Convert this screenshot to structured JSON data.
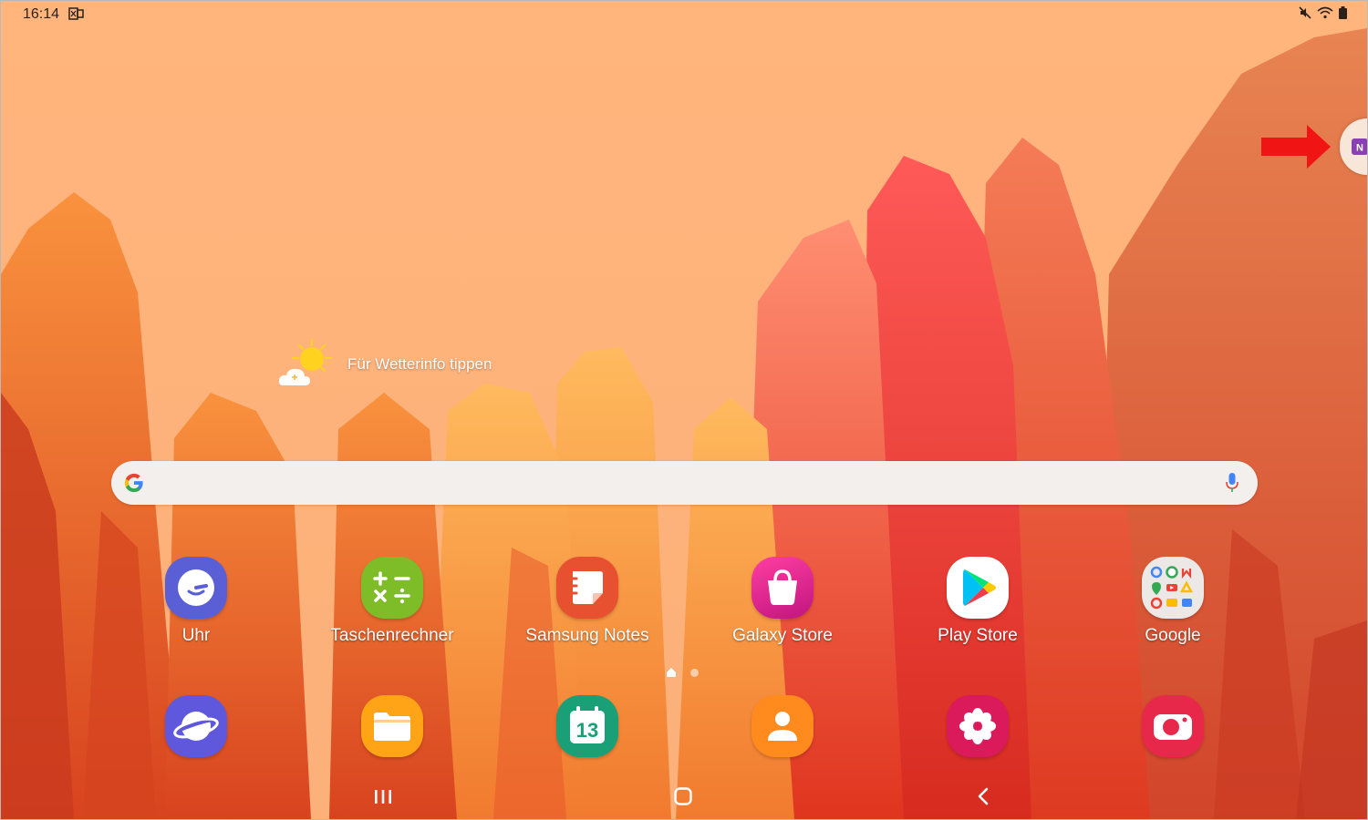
{
  "status_bar": {
    "time": "16:14",
    "icons": [
      "notification-icon",
      "mute-icon",
      "wifi-icon",
      "battery-icon"
    ]
  },
  "edge_panel": {
    "icon": "onenote-icon",
    "letter": "N",
    "annotation": "arrow-icon"
  },
  "weather": {
    "label": "Für Wetterinfo tippen",
    "icon": "sun-cloud-icon"
  },
  "search": {
    "placeholder": "",
    "value": "",
    "icons": [
      "google-icon",
      "mic-icon"
    ]
  },
  "apps_row1": [
    {
      "label": "Uhr",
      "icon": "clock-icon",
      "color": "#5b5fd6"
    },
    {
      "label": "Taschenrechner",
      "icon": "calculator-icon",
      "color": "#7ebc28"
    },
    {
      "label": "Samsung Notes",
      "icon": "notes-icon",
      "color": "#e8512f"
    },
    {
      "label": "Galaxy Store",
      "icon": "store-bag-icon",
      "color": "#e3247c"
    },
    {
      "label": "Play Store",
      "icon": "play-store-icon",
      "color": "#ffffff"
    },
    {
      "label": "Google",
      "icon": "google-folder-icon",
      "color": "#ece8e6"
    }
  ],
  "apps_dock": [
    {
      "icon": "internet-icon",
      "color": "#6058dc"
    },
    {
      "icon": "folder-icon",
      "color": "#ffa417"
    },
    {
      "icon": "calendar-icon",
      "color": "#1a9f77",
      "text": "13"
    },
    {
      "icon": "contacts-icon",
      "color": "#ff8a1e"
    },
    {
      "icon": "gallery-icon",
      "color": "#da1a5a"
    },
    {
      "icon": "camera-icon",
      "color": "#e8284a"
    }
  ],
  "page_indicator": {
    "current": 1,
    "total": 2
  },
  "nav_bar": [
    "recents-icon",
    "home-icon",
    "back-icon"
  ]
}
